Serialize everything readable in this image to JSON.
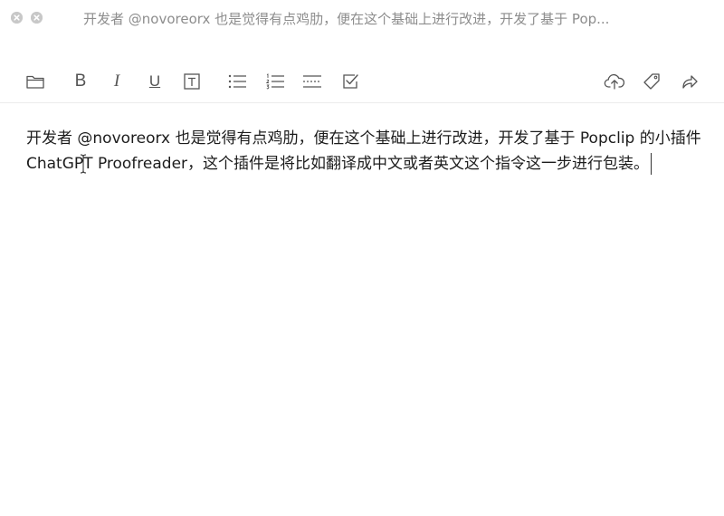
{
  "window": {
    "title": "开发者 @novoreorx 也是觉得有点鸡肋，便在这个基础上进行改进，开发了基于 Pop..."
  },
  "toolbar": {
    "items": [
      {
        "name": "folder",
        "icon": "folder-icon"
      },
      {
        "name": "bold",
        "label": "B"
      },
      {
        "name": "italic",
        "label": "I"
      },
      {
        "name": "underline",
        "label": "U"
      },
      {
        "name": "text-box",
        "icon": "text-box-icon"
      },
      {
        "name": "bullet-list",
        "icon": "bullet-list-icon"
      },
      {
        "name": "numbered-list",
        "icon": "numbered-list-icon"
      },
      {
        "name": "horizontal-rule",
        "icon": "dotted-lines-icon"
      },
      {
        "name": "checkbox",
        "icon": "checkbox-icon"
      },
      {
        "name": "upload",
        "icon": "cloud-upload-icon"
      },
      {
        "name": "tag",
        "icon": "tag-icon"
      },
      {
        "name": "share",
        "icon": "share-arrow-icon"
      }
    ],
    "bold_label": "B",
    "italic_label": "I",
    "underline_label": "U"
  },
  "editor": {
    "content": "开发者 @novoreorx 也是觉得有点鸡肋，便在这个基础上进行改进，开发了基于 Popclip 的小插件 ChatGPT Proofreader，这个插件是将比如翻译成中文或者英文这个指令这一步进行包装。"
  },
  "colors": {
    "icon": "#555555",
    "title_text": "#8d8d8d",
    "body_text": "#1c1c1c",
    "window_button": "#c8c8c8"
  }
}
